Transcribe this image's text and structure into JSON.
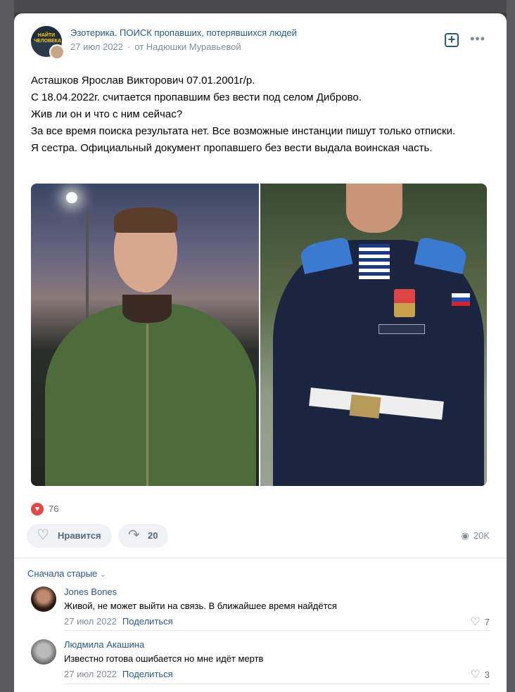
{
  "post": {
    "group_name": "Эзотерика. ПОИСК пропавших, потерявшихся людей",
    "group_avatar_text": "НАЙТИ ЧЕЛОВЕКА",
    "date": "27 июл 2022",
    "separator": "·",
    "from": "от Надюшки Муравьевой",
    "text_lines": [
      "Асташков Ярослав Викторович 07.01.2001г/р.",
      "С 18.04.2022г. считается пропавшим без вести под селом Диброво.",
      "Жив ли он и что с ним сейчас?",
      "За все время поиска результата нет. Все возможные инстанции пишут только отписки.",
      "Я сестра. Официальный документ пропавшего без вести выдала воинская часть."
    ],
    "reactions_count": "76",
    "like_label": "Нравится",
    "share_count": "20",
    "views": "20K"
  },
  "icons": {
    "subscribe": "+",
    "more": "•••",
    "heart": "♡",
    "heart_filled": "♥",
    "share": "↷",
    "eye": "◉",
    "chevron": "⌄"
  },
  "comments": {
    "sort_label": "Сначала старые",
    "items": [
      {
        "author": "Jones Bones",
        "text": "Живой, не может выйти на связь. В ближайшее время найдётся",
        "date": "27 июл 2022",
        "share": "Поделиться",
        "likes": "7"
      },
      {
        "author": "Людмила Акашина",
        "text": "Известно готова ошибается но мне идёт мертв",
        "date": "27 июл 2022",
        "share": "Поделиться",
        "likes": "3"
      }
    ]
  },
  "colors": {
    "link": "#2a5885",
    "secondary": "#818c99",
    "like_red": "#e64646",
    "button_bg": "#f0f2f5"
  }
}
